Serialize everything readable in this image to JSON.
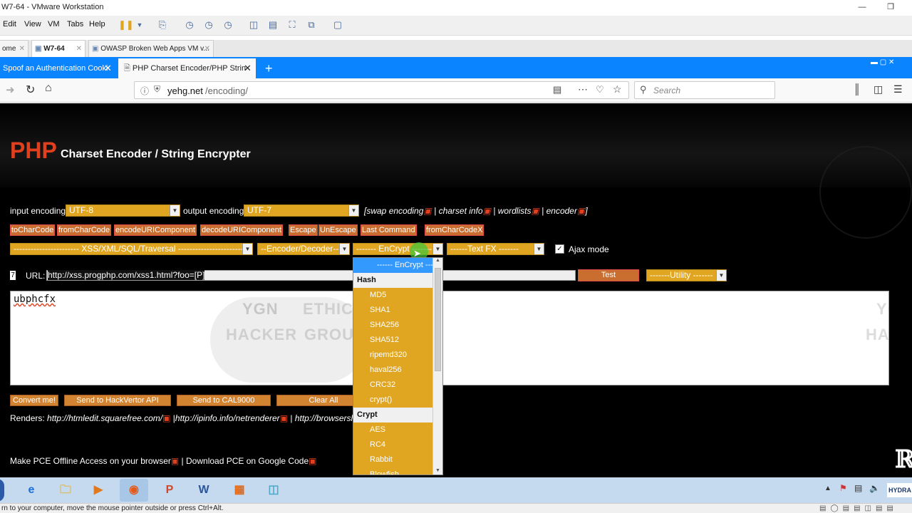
{
  "vm": {
    "title": "W7-64 - VMware Workstation",
    "menu": [
      "Edit",
      "View",
      "VM",
      "Tabs",
      "Help"
    ],
    "tabs": [
      "ome",
      "W7-64",
      "OWASP Broken Web Apps VM v..."
    ],
    "status_text": "rn to your computer, move the mouse pointer outside or press Ctrl+Alt."
  },
  "browser": {
    "tabs": [
      {
        "title": "Spoof an Authentication Cooki"
      },
      {
        "title": "PHP Charset Encoder/PHP Strin"
      }
    ],
    "new_tab": "+",
    "url_domain": "yehg.net",
    "url_path": "/encoding/",
    "search_placeholder": "Search"
  },
  "page": {
    "title_php": "PHP",
    "title_rest": "Charset Encoder / String Encrypter",
    "input_encoding_label": "input encoding",
    "input_encoding_value": "UTF-8",
    "output_encoding_label": "output encoding",
    "output_encoding_value": "UTF-7",
    "links": {
      "open": "[",
      "swap": "swap encoding",
      "charset": "charset info",
      "wordlists": "wordlists",
      "encoder": "encoder",
      "sep": "|",
      "close": "]"
    },
    "buttons_row1": [
      "toCharCode",
      "fromCharCode",
      "encodeURIComponent",
      "decodeURIComponent",
      "Escape",
      "UnEscape",
      "Last Command",
      "fromCharCodeX"
    ],
    "select_xss": "----------------------- XSS/XML/SQL/Traversal -----------------------",
    "select_encoder": "--Encoder/Decoder--",
    "select_encrypt": "------- EnCrypt -------",
    "select_textfx": "------Text FX -------",
    "ajax_label": "Ajax mode",
    "ajax_checked": true,
    "url_label": "URL:",
    "url_value": "http://xss.progphp.com/xss1.html?foo=[P]",
    "test_button": "Test",
    "utility_select": "-------Utility -------",
    "textarea_value": "ubphcfx",
    "ghost_text": [
      "YGN",
      "ETHICA",
      "HACKER",
      "GROU",
      "YGN",
      "HACK"
    ],
    "bottom_buttons": [
      "Convert me!",
      "Send to HackVertor API",
      "Send to CAL9000",
      "Clear All"
    ],
    "renders_label": "Renders:",
    "renders_links": [
      "http://htmledit.squarefree.com/",
      "http://ipinfo.info/netrenderer",
      "http://browsershots."
    ],
    "offline_text": "Make PCE Offline Access on your browser",
    "download_text": "Download PCE on Google Code",
    "checkbox_mark": "7"
  },
  "dropdown": {
    "options": [
      {
        "type": "selected",
        "label": "------ EnCrypt ------"
      },
      {
        "type": "group",
        "label": "Hash"
      },
      {
        "type": "option",
        "label": "MD5"
      },
      {
        "type": "option",
        "label": "SHA1"
      },
      {
        "type": "option",
        "label": "SHA256"
      },
      {
        "type": "option",
        "label": "SHA512"
      },
      {
        "type": "option",
        "label": "ripemd320"
      },
      {
        "type": "option",
        "label": "haval256"
      },
      {
        "type": "option",
        "label": "CRC32"
      },
      {
        "type": "option",
        "label": "crypt()"
      },
      {
        "type": "group",
        "label": "Crypt"
      },
      {
        "type": "option",
        "label": "AES"
      },
      {
        "type": "option",
        "label": "RC4"
      },
      {
        "type": "option",
        "label": "Rabbit"
      },
      {
        "type": "option",
        "label": "Blowfish"
      }
    ]
  },
  "taskbar": {
    "tray_label": "HYDRA"
  },
  "colors": {
    "orange": "#e0a521",
    "php_red": "#e0401e",
    "firefox_blue": "#0a84ff",
    "dropdown_selected": "#3399ff"
  }
}
